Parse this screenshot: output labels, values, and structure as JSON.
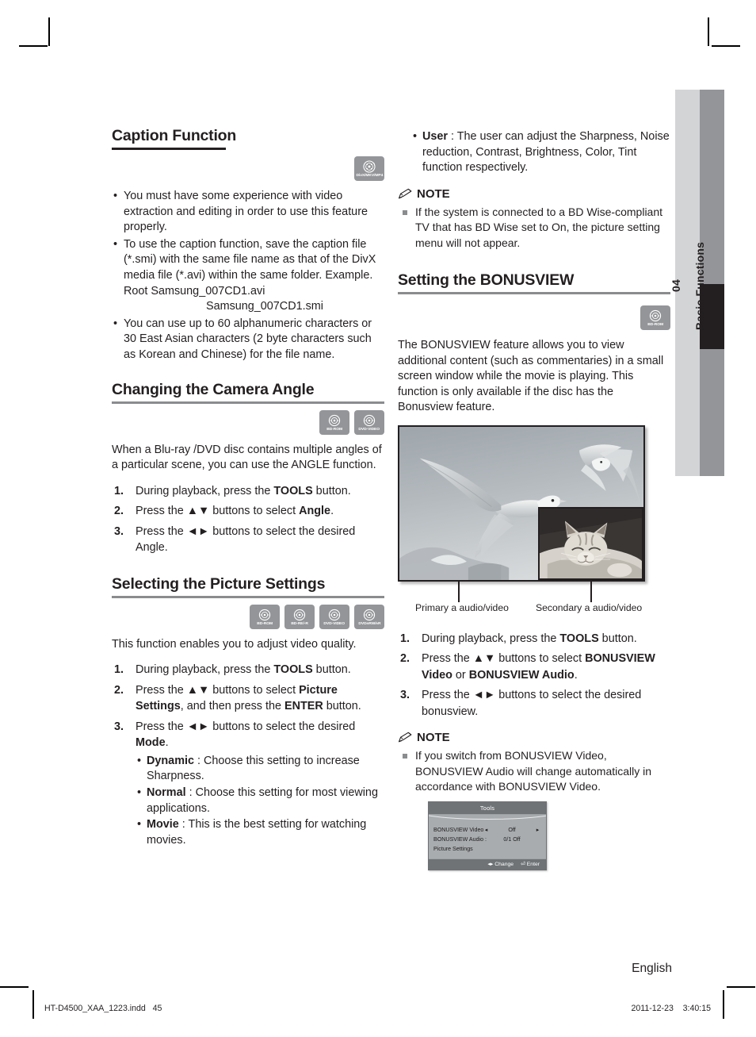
{
  "page": {
    "language": "English",
    "footer_file": "HT-D4500_XAA_1223.indd   45",
    "footer_date": "2011-12-23",
    "footer_time": "3:40:15",
    "chapter_number": "04",
    "chapter_name": "Basic Functions",
    "colors": {
      "tab_light": "#d3d4d6",
      "tab_mid": "#939598",
      "tab_marker": "#231f20",
      "badge_gray": "#939598",
      "text": "#231f20"
    }
  },
  "left_column": {
    "caption_function": {
      "title": "Caption Function",
      "badges": [
        {
          "label": "DivX/MKV/MP4",
          "icon": "disc-icon"
        }
      ],
      "bullets": [
        "You must have some experience with video extraction and editing in order to use this feature properly.",
        "To use the caption function, save the caption file (*.smi) with the same file name as that of the DivX media file (*.avi) within the same folder. Example. Root Samsung_007CD1.avi",
        "You can use up to 60 alphanumeric characters or 30 East Asian characters (2 byte characters such as Korean and Chinese) for the file name."
      ],
      "bullet2_indent_line": "Samsung_007CD1.smi"
    },
    "camera_angle": {
      "title": "Changing the Camera Angle",
      "badges": [
        {
          "label": "BD-ROM",
          "icon": "disc-icon"
        },
        {
          "label": "DVD-VIDEO",
          "icon": "disc-icon"
        }
      ],
      "intro": "When a Blu-ray /DVD disc contains multiple angles of a particular scene, you can use the ANGLE function.",
      "steps": [
        {
          "num": "1.",
          "text_before": "During playback, press the ",
          "bold": "TOOLS",
          "text_after": " button."
        },
        {
          "num": "2.",
          "text_before": "Press the ▲▼ buttons to select ",
          "bold": "Angle",
          "text_after": "."
        },
        {
          "num": "3.",
          "text_before": "Press the ◄► buttons to select the desired ",
          "bold": "",
          "text_after": "Angle."
        }
      ]
    },
    "picture_settings": {
      "title": "Selecting the Picture Settings",
      "badges": [
        {
          "label": "BD-ROM",
          "icon": "disc-icon"
        },
        {
          "label": "BD-RE/-R",
          "icon": "disc-icon"
        },
        {
          "label": "DVD-VIDEO",
          "icon": "disc-icon"
        },
        {
          "label": "DVD±RW/±R",
          "icon": "disc-icon"
        }
      ],
      "intro": "This function enables you to adjust video quality.",
      "steps": [
        {
          "num": "1.",
          "parts": [
            {
              "t": "During playback, press the ",
              "b": false
            },
            {
              "t": "TOOLS",
              "b": true
            },
            {
              "t": " button.",
              "b": false
            }
          ]
        },
        {
          "num": "2.",
          "parts": [
            {
              "t": "Press the ▲▼ buttons to select ",
              "b": false
            },
            {
              "t": "Picture Settings",
              "b": true
            },
            {
              "t": ", and then press the ",
              "b": false
            },
            {
              "t": "ENTER",
              "b": true
            },
            {
              "t": " button.",
              "b": false
            }
          ]
        },
        {
          "num": "3.",
          "parts": [
            {
              "t": "Press the ◄► buttons to select the desired ",
              "b": false
            },
            {
              "t": "Mode",
              "b": true
            },
            {
              "t": ".",
              "b": false
            }
          ]
        }
      ],
      "mode_bullets": [
        {
          "name": "Dynamic",
          "desc": " : Choose this setting to increase Sharpness."
        },
        {
          "name": "Normal",
          "desc": " : Choose this setting for most viewing applications."
        },
        {
          "name": "Movie",
          "desc": " : This is the best setting for watching movies."
        }
      ]
    }
  },
  "right_column": {
    "user_bullet": {
      "name": "User",
      "desc": " : The user can adjust the Sharpness, Noise reduction, Contrast, Brightness, Color, Tint function respectively."
    },
    "note1": {
      "label": "NOTE",
      "icon": "pencil-icon",
      "items": [
        "If the system is connected to a BD Wise-compliant TV that has BD Wise set to On, the picture setting menu will not appear."
      ]
    },
    "bonusview": {
      "title": "Setting the BONUSVIEW",
      "badges": [
        {
          "label": "BD-ROM",
          "icon": "disc-icon"
        }
      ],
      "intro": "The BONUSVIEW feature allows you to view additional content (such as commentaries) in a small screen window while the movie is playing. This function is only available if the disc has the Bonusview feature.",
      "figure": {
        "caption_primary": "Primary a audio/video",
        "caption_secondary": "Secondary a audio/video",
        "main_image_alt": "seagull-photo",
        "pip_image_alt": "sleeping-cat-photo"
      },
      "steps": [
        {
          "num": "1.",
          "parts": [
            {
              "t": "During playback, press the ",
              "b": false
            },
            {
              "t": "TOOLS",
              "b": true
            },
            {
              "t": " button.",
              "b": false
            }
          ]
        },
        {
          "num": "2.",
          "parts": [
            {
              "t": "Press the ▲▼ buttons to select ",
              "b": false
            },
            {
              "t": "BONUSVIEW Video",
              "b": true
            },
            {
              "t": " or ",
              "b": false
            },
            {
              "t": "BONUSVIEW Audio",
              "b": true
            },
            {
              "t": ".",
              "b": false
            }
          ]
        },
        {
          "num": "3.",
          "parts": [
            {
              "t": "Press the ◄► buttons to select the desired bonusview.",
              "b": false
            }
          ]
        }
      ],
      "note2": {
        "label": "NOTE",
        "icon": "pencil-icon",
        "items": [
          "If you switch from BONUSVIEW Video, BONUSVIEW Audio will change automatically in accordance with BONUSVIEW Video."
        ]
      },
      "osd": {
        "title": "Tools",
        "rows": [
          {
            "key": "BONUSVIEW Video",
            "left_arrow": "◂",
            "value": "Off",
            "right_arrow": "▸"
          },
          {
            "key": "BONUSVIEW Audio :",
            "left_arrow": "",
            "value": "0/1 Off",
            "right_arrow": ""
          },
          {
            "key": "Picture Settings",
            "left_arrow": "",
            "value": "",
            "right_arrow": ""
          }
        ],
        "footer_change": "Change",
        "footer_enter": "Enter",
        "footer_change_icon": "◂▸",
        "footer_enter_icon": "⏎"
      }
    }
  }
}
